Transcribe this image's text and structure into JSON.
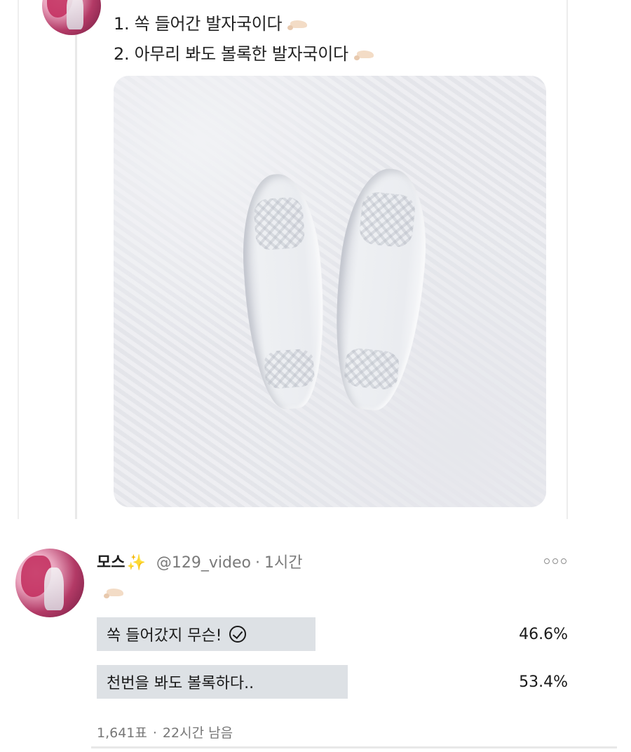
{
  "top_tweet": {
    "lines": [
      "1. 쏙 들어간 발자국이다",
      "2. 아무리 봐도 볼록한 발자국이다"
    ],
    "line_emoji": "foot-emoji",
    "image": "footprints-in-snow"
  },
  "reply": {
    "name": "모스",
    "name_emoji": "✨",
    "handle": "@129_video",
    "separator": "·",
    "time": "1시간",
    "body_emoji": "foot-emoji",
    "poll": {
      "options": [
        {
          "label": "쏙 들어갔지 무슨!",
          "percent": "46.6%",
          "selected": true
        },
        {
          "label": "천번을 봐도 볼록하다..",
          "percent": "53.4%",
          "selected": false
        }
      ],
      "votes": "1,641표",
      "separator": "·",
      "remaining": "22시간 남음"
    }
  },
  "colors": {
    "poll_bar": "#dde1e5",
    "muted_text": "#7a7a7a",
    "sparkle": "#f4b400"
  }
}
